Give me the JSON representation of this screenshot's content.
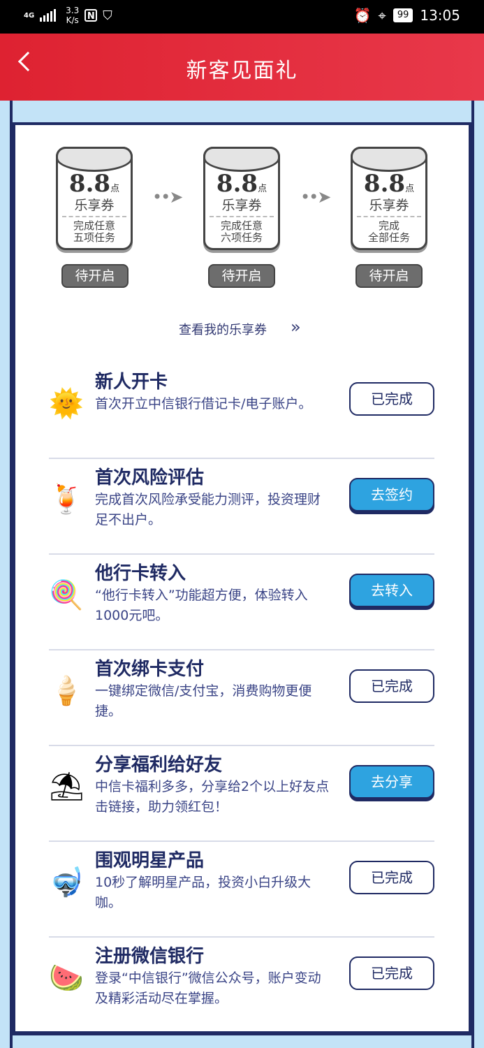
{
  "status": {
    "network": "4G",
    "speed_value": "3.3",
    "speed_unit": "K/s",
    "nfc": "N",
    "battery": "99",
    "time": "13:05"
  },
  "header": {
    "title": "新客见面礼"
  },
  "vouchers": [
    {
      "value": "8.8",
      "unit": "点",
      "name": "乐享券",
      "desc_line1": "完成任意",
      "desc_line2": "五项任务",
      "status": "待开启"
    },
    {
      "value": "8.8",
      "unit": "点",
      "name": "乐享券",
      "desc_line1": "完成任意",
      "desc_line2": "六项任务",
      "status": "待开启"
    },
    {
      "value": "8.8",
      "unit": "点",
      "name": "乐享券",
      "desc_line1": "完成",
      "desc_line2": "全部任务",
      "status": "待开启"
    }
  ],
  "view_link": "查看我的乐享券",
  "tasks": [
    {
      "name": "新人开卡",
      "desc": "首次开立中信银行借记卡/电子账户。",
      "button": "已完成",
      "icon": "sun-icon",
      "done": true
    },
    {
      "name": "首次风险评估",
      "desc": "完成首次风险承受能力测评，投资理财足不出户。",
      "button": "去签约",
      "icon": "cocktail-icon",
      "done": false
    },
    {
      "name": "他行卡转入",
      "desc": "“他行卡转入”功能超方便，体验转入1000元吧。",
      "button": "去转入",
      "icon": "popsicle-icon",
      "done": false
    },
    {
      "name": "首次绑卡支付",
      "desc": "一键绑定微信/支付宝，消费购物更便捷。",
      "button": "已完成",
      "icon": "ice-cream-icon",
      "done": true
    },
    {
      "name": "分享福利给好友",
      "desc": "中信卡福利多多，分享给2个以上好友点击链接，助力领红包！",
      "button": "去分享",
      "icon": "beach-umbrella-icon",
      "done": false
    },
    {
      "name": "围观明星产品",
      "desc": "10秒了解明星产品，投资小白升级大咖。",
      "button": "已完成",
      "icon": "snorkel-icon",
      "done": true
    },
    {
      "name": "注册微信银行",
      "desc": "登录“中信银行”微信公众号，账户变动及精彩活动尽在掌握。",
      "button": "已完成",
      "icon": "watermelon-icon",
      "done": true
    }
  ]
}
